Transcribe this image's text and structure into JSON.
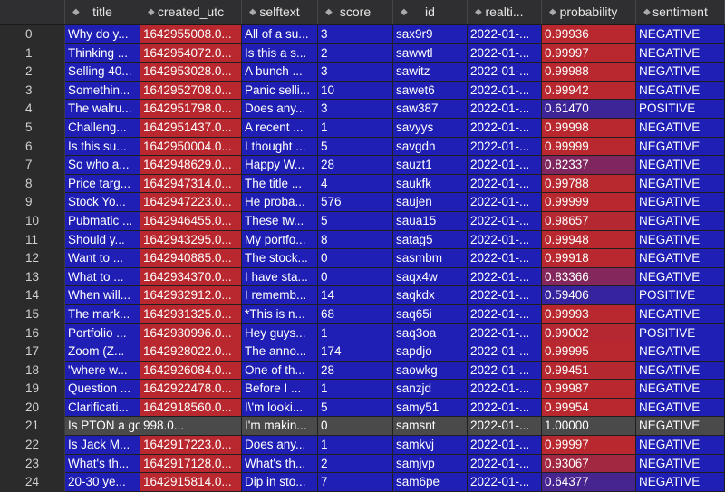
{
  "columns": [
    "title",
    "created_utc",
    "selftext",
    "score",
    "id",
    "realti...",
    "probability",
    "sentiment"
  ],
  "colors": {
    "blue": "#1f1fb5",
    "red": "#b8282e",
    "highlight": "#4a4a4a"
  },
  "rows": [
    {
      "index": "0",
      "title": "Why do y...",
      "created_utc": "1642955008.0...",
      "selftext": "All of a su...",
      "score": "3",
      "id": "sax9r9",
      "realtime": "2022-01-...",
      "probability": "0.99936",
      "prob": 0.99936,
      "sentiment": "NEGATIVE"
    },
    {
      "index": "1",
      "title": "Thinking ...",
      "created_utc": "1642954072.0...",
      "selftext": "Is this a s...",
      "score": "2",
      "id": "sawwtl",
      "realtime": "2022-01-...",
      "probability": "0.99997",
      "prob": 0.99997,
      "sentiment": "NEGATIVE"
    },
    {
      "index": "2",
      "title": "Selling 40...",
      "created_utc": "1642953028.0...",
      "selftext": "A bunch ...",
      "score": "3",
      "id": "sawitz",
      "realtime": "2022-01-...",
      "probability": "0.99988",
      "prob": 0.99988,
      "sentiment": "NEGATIVE"
    },
    {
      "index": "3",
      "title": "Somethin...",
      "created_utc": "1642952708.0...",
      "selftext": "Panic selli...",
      "score": "10",
      "id": "sawet6",
      "realtime": "2022-01-...",
      "probability": "0.99942",
      "prob": 0.99942,
      "sentiment": "NEGATIVE"
    },
    {
      "index": "4",
      "title": "The walru...",
      "created_utc": "1642951798.0...",
      "selftext": "Does any...",
      "score": "3",
      "id": "saw387",
      "realtime": "2022-01-...",
      "probability": "0.61470",
      "prob": 0.6147,
      "sentiment": "POSITIVE"
    },
    {
      "index": "5",
      "title": "Challeng...",
      "created_utc": "1642951437.0...",
      "selftext": "A recent ...",
      "score": "1",
      "id": "savyys",
      "realtime": "2022-01-...",
      "probability": "0.99998",
      "prob": 0.99998,
      "sentiment": "NEGATIVE"
    },
    {
      "index": "6",
      "title": "Is this su...",
      "created_utc": "1642950004.0...",
      "selftext": "I thought ...",
      "score": "5",
      "id": "savgdn",
      "realtime": "2022-01-...",
      "probability": "0.99999",
      "prob": 0.99999,
      "sentiment": "NEGATIVE"
    },
    {
      "index": "7",
      "title": "So who a...",
      "created_utc": "1642948629.0...",
      "selftext": "Happy W...",
      "score": "28",
      "id": "sauzt1",
      "realtime": "2022-01-...",
      "probability": "0.82337",
      "prob": 0.82337,
      "sentiment": "NEGATIVE"
    },
    {
      "index": "8",
      "title": "Price targ...",
      "created_utc": "1642947314.0...",
      "selftext": "The title ...",
      "score": "4",
      "id": "saukfk",
      "realtime": "2022-01-...",
      "probability": "0.99788",
      "prob": 0.99788,
      "sentiment": "NEGATIVE"
    },
    {
      "index": "9",
      "title": "Stock Yo...",
      "created_utc": "1642947223.0...",
      "selftext": "He proba...",
      "score": "576",
      "id": "saujen",
      "realtime": "2022-01-...",
      "probability": "0.99999",
      "prob": 0.99999,
      "sentiment": "NEGATIVE"
    },
    {
      "index": "10",
      "title": "Pubmatic ...",
      "created_utc": "1642946455.0...",
      "selftext": "These tw...",
      "score": "5",
      "id": "saua15",
      "realtime": "2022-01-...",
      "probability": "0.98657",
      "prob": 0.98657,
      "sentiment": "NEGATIVE"
    },
    {
      "index": "11",
      "title": "Should y...",
      "created_utc": "1642943295.0...",
      "selftext": "My portfo...",
      "score": "8",
      "id": "satag5",
      "realtime": "2022-01-...",
      "probability": "0.99948",
      "prob": 0.99948,
      "sentiment": "NEGATIVE"
    },
    {
      "index": "12",
      "title": "Want to ...",
      "created_utc": "1642940885.0...",
      "selftext": "The stock...",
      "score": "0",
      "id": "sasmbm",
      "realtime": "2022-01-...",
      "probability": "0.99918",
      "prob": 0.99918,
      "sentiment": "NEGATIVE"
    },
    {
      "index": "13",
      "title": "What to ...",
      "created_utc": "1642934370.0...",
      "selftext": "I have sta...",
      "score": "0",
      "id": "saqx4w",
      "realtime": "2022-01-...",
      "probability": "0.83366",
      "prob": 0.83366,
      "sentiment": "NEGATIVE"
    },
    {
      "index": "14",
      "title": "When will...",
      "created_utc": "1642932912.0...",
      "selftext": "I rememb...",
      "score": "14",
      "id": "saqkdx",
      "realtime": "2022-01-...",
      "probability": "0.59406",
      "prob": 0.59406,
      "sentiment": "POSITIVE"
    },
    {
      "index": "15",
      "title": "The mark...",
      "created_utc": "1642931325.0...",
      "selftext": "*This is n...",
      "score": "68",
      "id": "saq65i",
      "realtime": "2022-01-...",
      "probability": "0.99993",
      "prob": 0.99993,
      "sentiment": "NEGATIVE"
    },
    {
      "index": "16",
      "title": "Portfolio ...",
      "created_utc": "1642930996.0...",
      "selftext": "Hey guys...",
      "score": "1",
      "id": "saq3oa",
      "realtime": "2022-01-...",
      "probability": "0.99002",
      "prob": 0.99002,
      "sentiment": "POSITIVE"
    },
    {
      "index": "17",
      "title": "Zoom (Z...",
      "created_utc": "1642928022.0...",
      "selftext": "The anno...",
      "score": "174",
      "id": "sapdjo",
      "realtime": "2022-01-...",
      "probability": "0.99995",
      "prob": 0.99995,
      "sentiment": "NEGATIVE"
    },
    {
      "index": "18",
      "title": "\"where w...",
      "created_utc": "1642926084.0...",
      "selftext": "One of th...",
      "score": "28",
      "id": "saowkg",
      "realtime": "2022-01-...",
      "probability": "0.99451",
      "prob": 0.99451,
      "sentiment": "NEGATIVE"
    },
    {
      "index": "19",
      "title": "Question ...",
      "created_utc": "1642922478.0...",
      "selftext": "Before I ...",
      "score": "1",
      "id": "sanzjd",
      "realtime": "2022-01-...",
      "probability": "0.99987",
      "prob": 0.99987,
      "sentiment": "NEGATIVE"
    },
    {
      "index": "20",
      "title": "Clarificati...",
      "created_utc": "1642918560.0...",
      "selftext": "I\\'m looki...",
      "score": "5",
      "id": "samy51",
      "realtime": "2022-01-...",
      "probability": "0.99954",
      "prob": 0.99954,
      "sentiment": "NEGATIVE"
    },
    {
      "index": "21",
      "title": "Is PTON a good buy?",
      "created_utc": "998.0...",
      "selftext": "I'm makin...",
      "score": "0",
      "id": "samsnt",
      "realtime": "2022-01-...",
      "probability": "1.00000",
      "prob": 1.0,
      "sentiment": "NEGATIVE",
      "highlight": true
    },
    {
      "index": "22",
      "title": "Is Jack M...",
      "created_utc": "1642917223.0...",
      "selftext": "Does any...",
      "score": "1",
      "id": "samkvj",
      "realtime": "2022-01-...",
      "probability": "0.99997",
      "prob": 0.99997,
      "sentiment": "NEGATIVE"
    },
    {
      "index": "23",
      "title": "What's th...",
      "created_utc": "1642917128.0...",
      "selftext": "What's th...",
      "score": "2",
      "id": "samjvp",
      "realtime": "2022-01-...",
      "probability": "0.93067",
      "prob": 0.93067,
      "sentiment": "NEGATIVE"
    },
    {
      "index": "24",
      "title": "20-30 ye...",
      "created_utc": "1642915814.0...",
      "selftext": "Dip in sto...",
      "score": "7",
      "id": "sam6pe",
      "realtime": "2022-01-...",
      "probability": "0.64377",
      "prob": 0.64377,
      "sentiment": "NEGATIVE"
    }
  ]
}
